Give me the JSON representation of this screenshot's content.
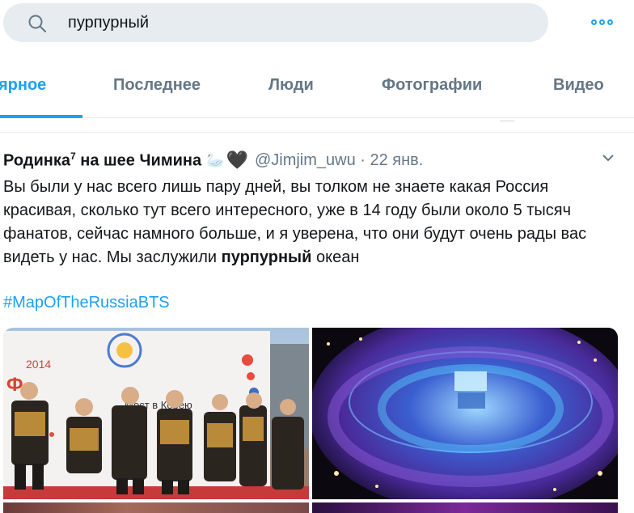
{
  "search": {
    "query": "пурпурный"
  },
  "tabs": [
    {
      "label": "ярное",
      "active": true
    },
    {
      "label": "Последнее",
      "active": false
    },
    {
      "label": "Люди",
      "active": false
    },
    {
      "label": "Фотографии",
      "active": false
    },
    {
      "label": "Видео",
      "active": false
    }
  ],
  "tweet": {
    "name": "Родинка",
    "name_sup": "7",
    "name_rest": " на шее Чимина",
    "emoji_swan": "🦢",
    "emoji_heart": "🖤",
    "handle": "@Jimjim_uwu",
    "separator": " · ",
    "date": "22 янв.",
    "text_before": "Вы были у нас всего лишь пару дней, вы толком не знаете какая Россия красивая, сколько тут всего интересного, уже в 14 году были около 5 тысяч фанатов, сейчас намного больше, и я уверена, что они будут очень рады вас видеть у нас. Мы заслужили ",
    "text_bold": "пурпурный",
    "text_after": " океан",
    "hashtag": "#MapOfTheRussiaBTS",
    "photo1_sign_year": "2014",
    "photo1_sign_text": "Мост в Корею"
  },
  "colors": {
    "accent": "#1da1f2",
    "text": "#14171a",
    "muted": "#657786",
    "search_bg": "#e6ecf0"
  }
}
